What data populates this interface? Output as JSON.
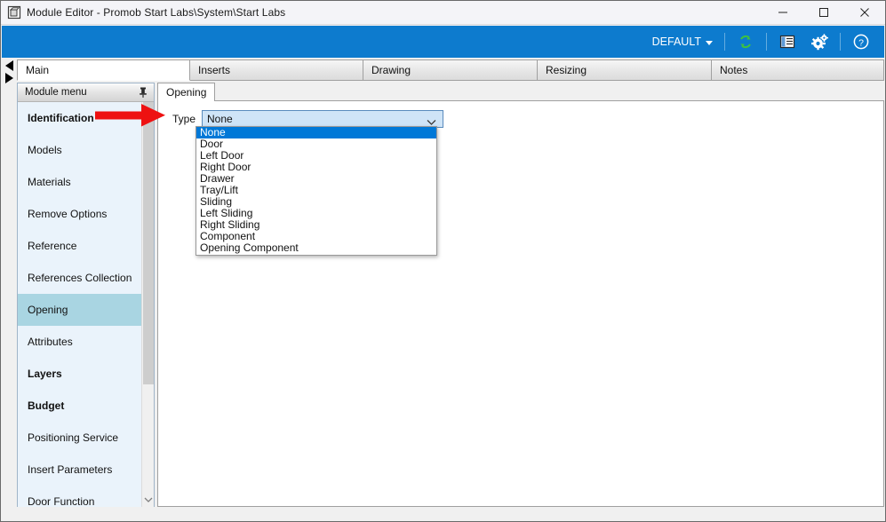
{
  "window": {
    "title": "Module Editor - Promob Start Labs\\System\\Start Labs",
    "icon": "module-cube-icon",
    "minimize_label": "—",
    "maximize_label": "☐",
    "close_label": "✕"
  },
  "ribbon": {
    "default_label": "DEFAULT",
    "icons": [
      {
        "name": "refresh-sync-icon",
        "color": "#3fc23f"
      },
      {
        "name": "list-panel-icon",
        "color": "#ffffff"
      },
      {
        "name": "gears-settings-icon",
        "color": "#ffffff"
      },
      {
        "name": "help-question-icon",
        "color": "#ffffff"
      }
    ],
    "background": "#0d7bce"
  },
  "main_tabs": [
    {
      "label": "Main",
      "active": true
    },
    {
      "label": "Inserts",
      "active": false
    },
    {
      "label": "Drawing",
      "active": false
    },
    {
      "label": "Resizing",
      "active": false
    },
    {
      "label": "Notes",
      "active": false
    }
  ],
  "sidebar": {
    "header": "Module menu",
    "pin_icon": "pin-icon",
    "items": [
      {
        "label": "Identification",
        "bold": true,
        "selected": false
      },
      {
        "label": "Models",
        "bold": false,
        "selected": false
      },
      {
        "label": "Materials",
        "bold": false,
        "selected": false
      },
      {
        "label": "Remove Options",
        "bold": false,
        "selected": false
      },
      {
        "label": "Reference",
        "bold": false,
        "selected": false
      },
      {
        "label": "References Collection",
        "bold": false,
        "selected": false
      },
      {
        "label": "Opening",
        "bold": false,
        "selected": true
      },
      {
        "label": "Attributes",
        "bold": false,
        "selected": false
      },
      {
        "label": "Layers",
        "bold": true,
        "selected": false
      },
      {
        "label": "Budget",
        "bold": true,
        "selected": false
      },
      {
        "label": "Positioning Service",
        "bold": false,
        "selected": false
      },
      {
        "label": "Insert Parameters",
        "bold": false,
        "selected": false
      },
      {
        "label": "Door Function",
        "bold": false,
        "selected": false
      }
    ]
  },
  "content": {
    "tabs": [
      {
        "label": "Opening",
        "active": true
      }
    ],
    "type_label": "Type",
    "combo": {
      "value": "None",
      "expanded": true,
      "options": [
        "None",
        "Door",
        "Left Door",
        "Right Door",
        "Drawer",
        "Tray/Lift",
        "Sliding",
        "Left Sliding",
        "Right Sliding",
        "Component",
        "Opening Component"
      ],
      "selected_index": 0,
      "highlight_color": "#0078d7",
      "field_background": "#cfe4f7"
    }
  },
  "annotation": {
    "arrow_color": "#ee1111",
    "points_to": "sidebar-opening-area"
  }
}
